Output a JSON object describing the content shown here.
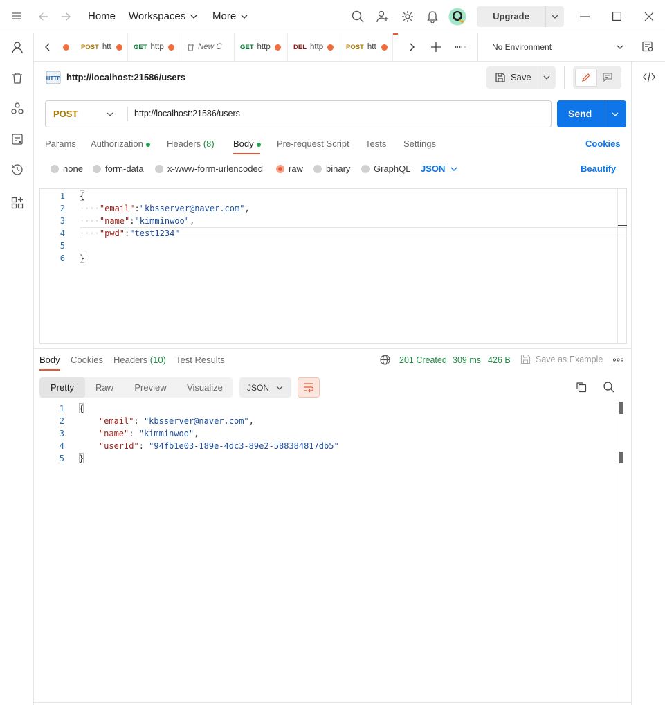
{
  "topbar": {
    "home": "Home",
    "workspaces": "Workspaces",
    "more": "More",
    "upgrade": "Upgrade"
  },
  "tabs": [
    {
      "method": "POST",
      "title": "htt",
      "method_color": "#ad7a03"
    },
    {
      "method": "GET",
      "title": "http",
      "method_color": "#007f31"
    },
    {
      "method": "",
      "title": "New C",
      "method_color": "#6b6b6b"
    },
    {
      "method": "GET",
      "title": "http",
      "method_color": "#007f31"
    },
    {
      "method": "DEL",
      "title": "http",
      "method_color": "#8e1a10"
    },
    {
      "method": "POST",
      "title": "htt",
      "method_color": "#ad7a03"
    }
  ],
  "environment": "No Environment",
  "request": {
    "name": "http://localhost:21586/users",
    "method": "POST",
    "url": "http://localhost:21586/users",
    "save": "Save",
    "send": "Send",
    "tabs": {
      "params": "Params",
      "authorization": "Authorization",
      "headers": "Headers",
      "headers_count": "(8)",
      "body": "Body",
      "prerequest": "Pre-request Script",
      "tests": "Tests",
      "settings": "Settings"
    },
    "cookies": "Cookies",
    "body_options": {
      "none": "none",
      "form_data": "form-data",
      "urlencoded": "x-www-form-urlencoded",
      "raw": "raw",
      "binary": "binary",
      "graphql": "GraphQL"
    },
    "body_format": "JSON",
    "beautify": "Beautify",
    "code_lines": [
      "1",
      "2",
      "3",
      "4",
      "5",
      "6"
    ],
    "code": {
      "open": "{",
      "email_key": "\"email\"",
      "email_val": "\"kbsserver@naver.com\"",
      "name_key": "\"name\"",
      "name_val": "\"kimminwoo\"",
      "pwd_key": "\"pwd\"",
      "pwd_val": "\"test1234\"",
      "close": "}"
    }
  },
  "response": {
    "tabs": {
      "body": "Body",
      "cookies": "Cookies",
      "headers": "Headers",
      "headers_count": "(10)",
      "test_results": "Test Results"
    },
    "status": "201 Created",
    "time": "309 ms",
    "size": "426 B",
    "save_example": "Save as Example",
    "views": {
      "pretty": "Pretty",
      "raw": "Raw",
      "preview": "Preview",
      "visualize": "Visualize"
    },
    "format": "JSON",
    "code_lines": [
      "1",
      "2",
      "3",
      "4",
      "5"
    ],
    "code": {
      "open": "{",
      "email_key": "\"email\"",
      "email_val": "\"kbsserver@naver.com\"",
      "name_key": "\"name\"",
      "name_val": "\"kimminwoo\"",
      "userid_key": "\"userId\"",
      "userid_val": "\"94fb1e03-189e-4dc3-89e2-588384817db5\"",
      "close": "}"
    }
  },
  "colors": {
    "accent": "#0e76e8",
    "orange": "#e8582f",
    "post": "#ad7a03",
    "status_ok": "#1f8a43"
  }
}
